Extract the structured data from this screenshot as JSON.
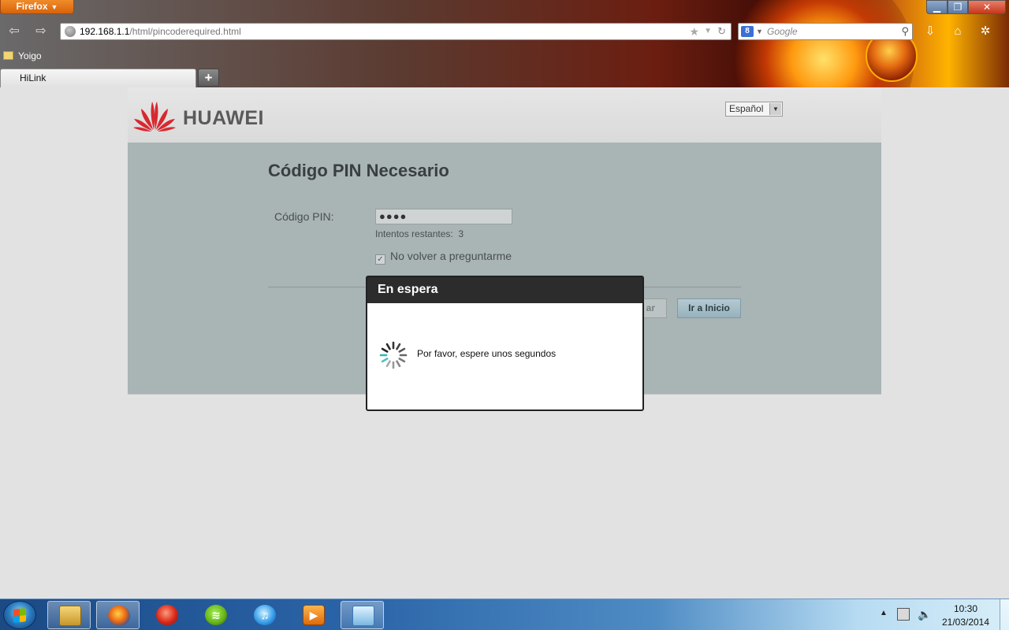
{
  "browser": {
    "menu_label": "Firefox",
    "url_host": "192.168.1.1",
    "url_path": "/html/pincoderequired.html",
    "search_placeholder": "Google",
    "bookmark": "Yoigo",
    "tab_title": "HiLink",
    "new_tab_label": "+",
    "icons": {
      "back": "back-arrow-icon",
      "forward": "forward-arrow-icon",
      "site": "globe-icon",
      "bookmark_star": "star-icon",
      "reload": "reload-icon",
      "search": "magnifier-icon",
      "download": "download-icon",
      "home": "home-icon",
      "addon": "addon-icon"
    }
  },
  "window_controls": {
    "minimize": "minimize-icon",
    "maximize": "maximize-icon",
    "close": "close-icon"
  },
  "header": {
    "brand": "HUAWEI",
    "language": "Español"
  },
  "form": {
    "title": "Código PIN Necesario",
    "pin_label": "Código PIN:",
    "pin_value": "●●●●",
    "attempts_label": "Intentos restantes:",
    "attempts_value": "3",
    "remember_label": "No volver a preguntarme",
    "remember_checked": true,
    "apply_label": "ar",
    "home_label": "Ir a Inicio"
  },
  "modal": {
    "title": "En espera",
    "message": "Por favor, espere unos segundos"
  },
  "taskbar": {
    "apps": [
      "explorer",
      "firefox",
      "ccleaner",
      "spotify",
      "itunes",
      "media-player",
      "network-monitor"
    ],
    "clock_time": "10:30",
    "clock_date": "21/03/2014"
  },
  "colors": {
    "modal_header": "#2c2c2c",
    "content_bg": "#a9b4b5",
    "huawei_red": "#d7282f",
    "button_blue": "#a7bfc8"
  }
}
